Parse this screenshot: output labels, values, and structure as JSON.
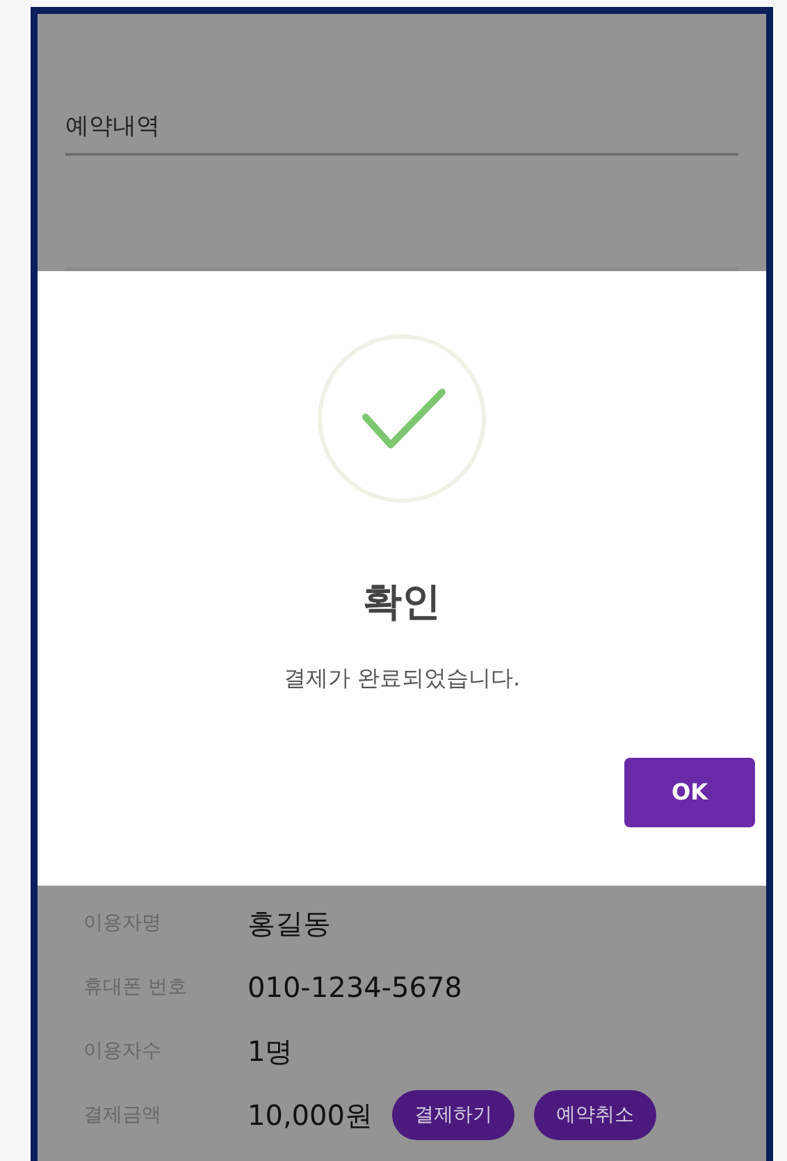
{
  "header": {
    "title": "예약내역"
  },
  "dialog": {
    "title": "확인",
    "message": "결제가 완료되었습니다.",
    "ok_button": "OK"
  },
  "details": [
    {
      "label": "이용자명",
      "value": "홍길동"
    },
    {
      "label": "휴대폰 번호",
      "value": "010-1234-5678"
    },
    {
      "label": "이용자수",
      "value": "1명"
    },
    {
      "label": "결제금액",
      "value": "10,000원"
    }
  ],
  "actions": [
    "결제하기",
    "예약취소"
  ]
}
